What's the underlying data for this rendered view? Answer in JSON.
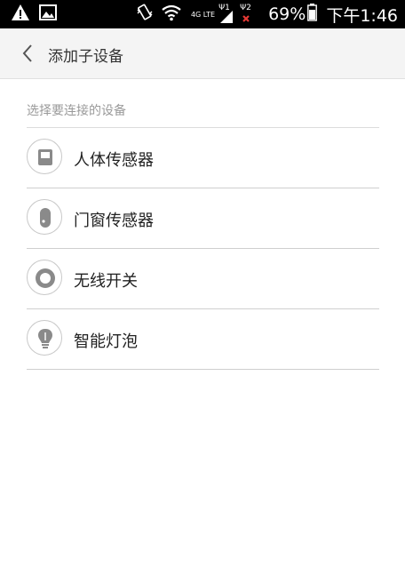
{
  "status_bar": {
    "network_label": "4G LTE",
    "sim1_label": "Ψ1",
    "sim2_label": "Ψ2",
    "battery_percent": "69%",
    "time": "下午1:46",
    "icons": [
      "warning-icon",
      "image-notification-icon",
      "vibrate-icon",
      "wifi-icon",
      "signal-icon",
      "no-signal-icon",
      "battery-icon"
    ]
  },
  "header": {
    "title": "添加子设备",
    "back_icon": "chevron-left-icon"
  },
  "section": {
    "label": "选择要连接的设备"
  },
  "devices": [
    {
      "label": "人体传感器",
      "icon": "motion-sensor-icon"
    },
    {
      "label": "门窗传感器",
      "icon": "door-window-sensor-icon"
    },
    {
      "label": "无线开关",
      "icon": "wireless-switch-icon"
    },
    {
      "label": "智能灯泡",
      "icon": "smart-bulb-icon"
    }
  ],
  "colors": {
    "status_bar_bg": "#000000",
    "header_bg": "#f4f4f4",
    "icon_gray": "#8a8a8a",
    "divider": "#cfcfcf"
  }
}
